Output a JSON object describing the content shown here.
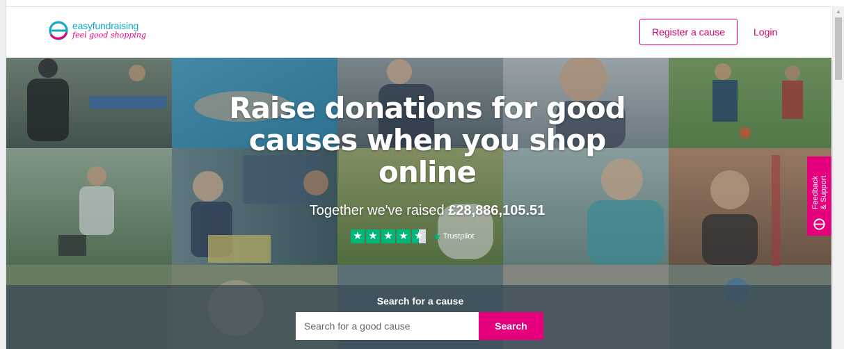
{
  "header": {
    "logo": {
      "name": "easyfundraising",
      "tagline": "feel good shopping",
      "icon": "easyfundraising-e-logo-icon"
    },
    "register_label": "Register a cause",
    "login_label": "Login"
  },
  "hero": {
    "headline": "Raise donations for good causes when you shop online",
    "raised_prefix": "Together we've raised",
    "raised_amount": "£28,886,105.51",
    "trustpilot": {
      "rating_stars": 4.5,
      "label": "Trustpilot"
    },
    "search": {
      "label": "Search for a cause",
      "placeholder": "Search for a good cause",
      "button_label": "Search"
    }
  },
  "feedback_tab": {
    "label_line1": "Feedback",
    "label_line2": "& Support",
    "icon": "easyfundraising-e-icon"
  },
  "colors": {
    "brand_pink": "#e6007e",
    "brand_teal": "#15a9c4",
    "trustpilot_green": "#00b67a"
  }
}
